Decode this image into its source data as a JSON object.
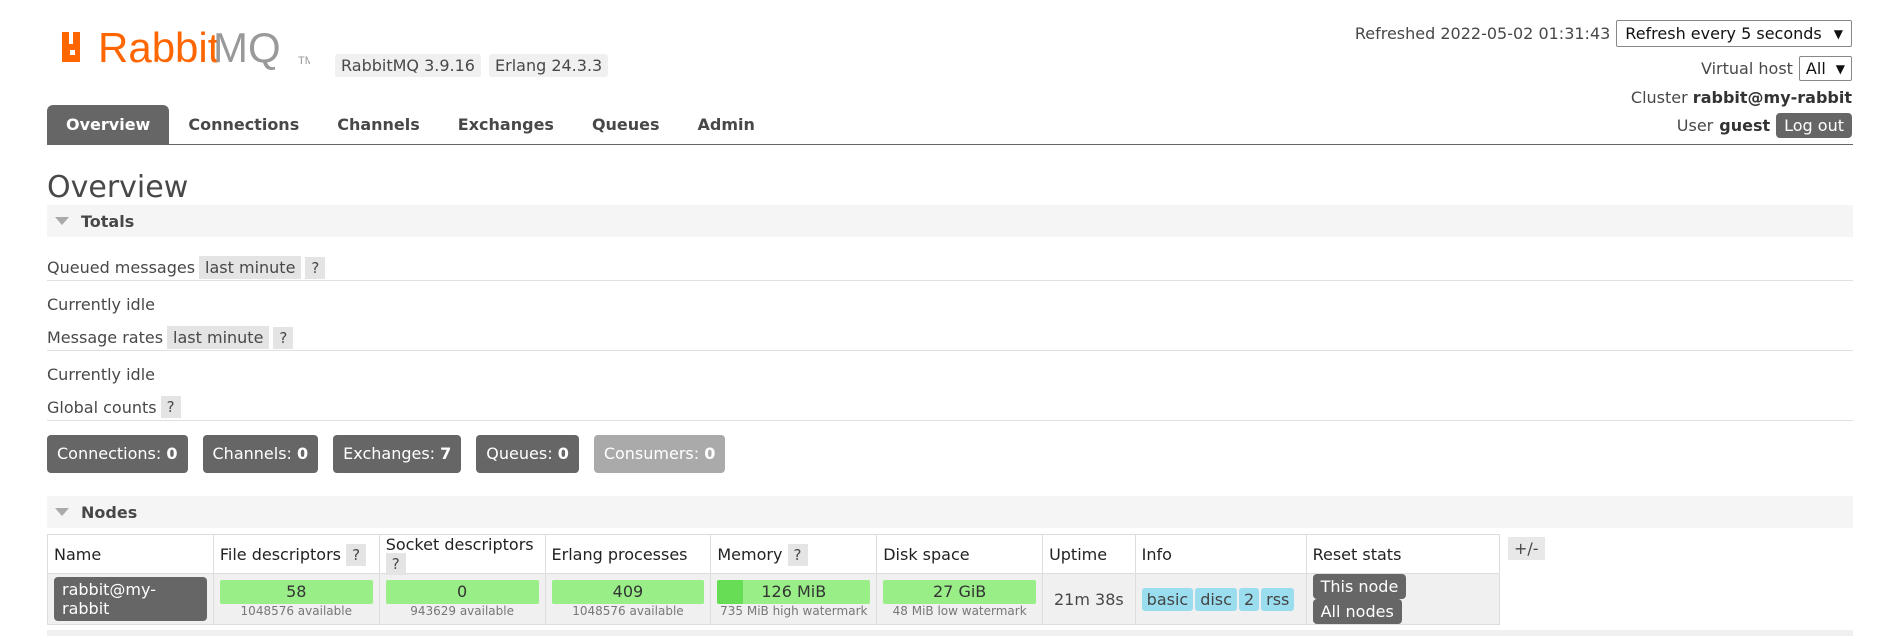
{
  "header": {
    "logo_text": "RabbitMQ",
    "logo_tm": "TM",
    "rabbitmq_version": "RabbitMQ 3.9.16",
    "erlang_version": "Erlang 24.3.3",
    "refreshed_text": "Refreshed 2022-05-02 01:31:43",
    "refresh_select": "Refresh every 5 seconds",
    "vhost_label": "Virtual host",
    "vhost_select": "All",
    "cluster_label": "Cluster",
    "cluster_name": "rabbit@my-rabbit",
    "user_label": "User",
    "user_name": "guest",
    "logout_label": "Log out"
  },
  "tabs": [
    {
      "label": "Overview",
      "active": true
    },
    {
      "label": "Connections"
    },
    {
      "label": "Channels"
    },
    {
      "label": "Exchanges"
    },
    {
      "label": "Queues"
    },
    {
      "label": "Admin"
    }
  ],
  "page_title": "Overview",
  "totals": {
    "heading": "Totals",
    "queued_label": "Queued messages",
    "queued_range": "last minute",
    "help": "?",
    "queued_status": "Currently idle",
    "rates_label": "Message rates",
    "rates_range": "last minute",
    "rates_status": "Currently idle",
    "global_label": "Global counts",
    "counts": {
      "connections_label": "Connections:",
      "connections": "0",
      "channels_label": "Channels:",
      "channels": "0",
      "exchanges_label": "Exchanges:",
      "exchanges": "7",
      "queues_label": "Queues:",
      "queues": "0",
      "consumers_label": "Consumers:",
      "consumers": "0"
    }
  },
  "nodes": {
    "heading": "Nodes",
    "plus_minus": "+/-",
    "columns": [
      "Name",
      "File descriptors",
      "Socket descriptors",
      "Erlang processes",
      "Memory",
      "Disk space",
      "Uptime",
      "Info",
      "Reset stats"
    ],
    "row": {
      "name": "rabbit@my-rabbit",
      "file_descriptors": "58",
      "file_descriptors_sub": "1048576 available",
      "socket_descriptors": "0",
      "socket_descriptors_sub": "943629 available",
      "erlang_processes": "409",
      "erlang_processes_sub": "1048576 available",
      "memory": "126 MiB",
      "memory_sub": "735 MiB high watermark",
      "memory_fraction": 0.17,
      "disk_space": "27 GiB",
      "disk_space_sub": "48 MiB low watermark",
      "uptime": "21m 38s",
      "info_badges": [
        "basic",
        "disc",
        "2",
        "rss"
      ],
      "reset_this": "This node",
      "reset_all": "All nodes"
    }
  },
  "colors": {
    "logo_orange": "#f60",
    "tab_active": "#666666",
    "bar_green": "#99ee88",
    "badge_blue": "#99ddee"
  }
}
